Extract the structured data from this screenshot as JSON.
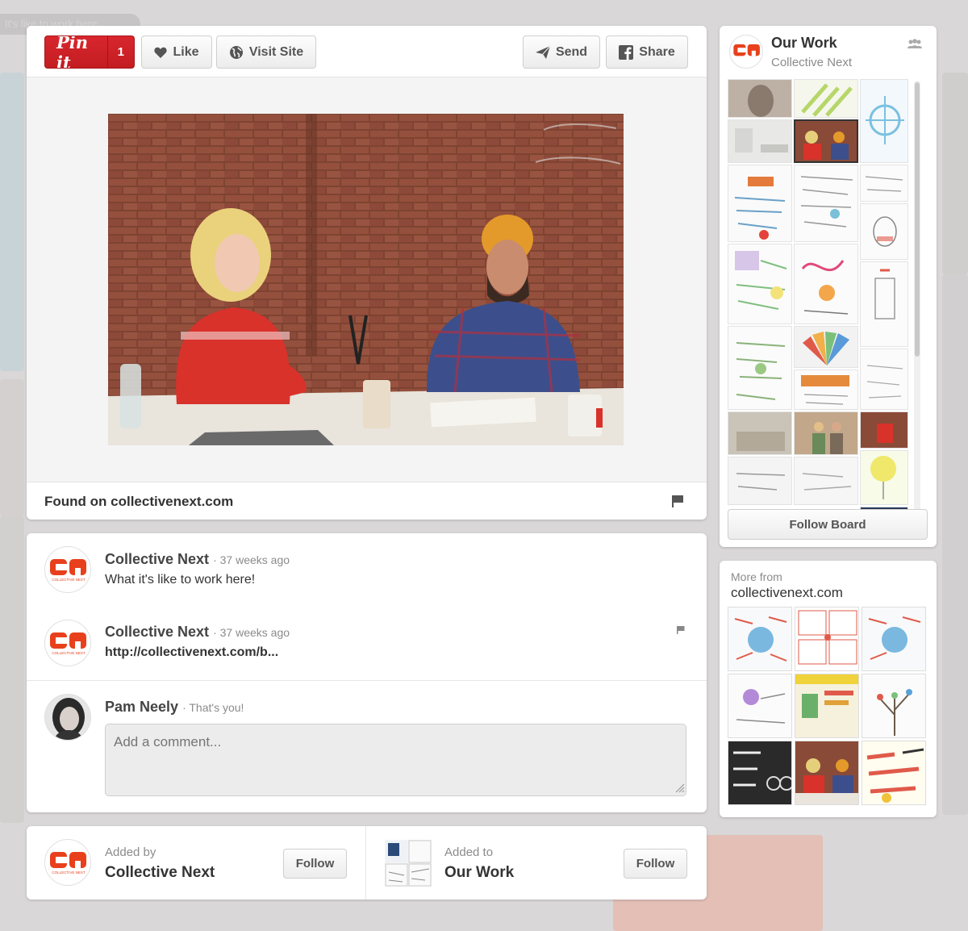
{
  "background": {
    "pill_text": "It's like to work here"
  },
  "pin": {
    "pinit_label": "Pin it",
    "pinit_count": "1",
    "like_label": "Like",
    "visit_label": "Visit Site",
    "send_label": "Send",
    "share_label": "Share",
    "found_text": "Found on collectivenext.com"
  },
  "comments": [
    {
      "author": "Collective Next",
      "meta": "· 37 weeks ago",
      "text": "What it's like to work here!"
    },
    {
      "author": "Collective Next",
      "meta": "· 37 weeks ago",
      "text": "http://collectivenext.com/b..."
    }
  ],
  "current_user": {
    "name": "Pam Neely",
    "meta": "· That's you!",
    "comment_placeholder": "Add a comment..."
  },
  "added_by": {
    "label": "Added by",
    "name": "Collective Next",
    "follow_label": "Follow"
  },
  "added_to": {
    "label": "Added to",
    "name": "Our Work",
    "follow_label": "Follow"
  },
  "board": {
    "title": "Our Work",
    "owner": "Collective Next",
    "follow_label": "Follow Board"
  },
  "more_from": {
    "label": "More from",
    "source": "collectivenext.com"
  },
  "logo": {
    "small_text": "COLLECTIVE NEXT"
  },
  "colors": {
    "pinit_red": "#cb2027",
    "logo_orange": "#e8401c",
    "button_text": "#555555"
  }
}
